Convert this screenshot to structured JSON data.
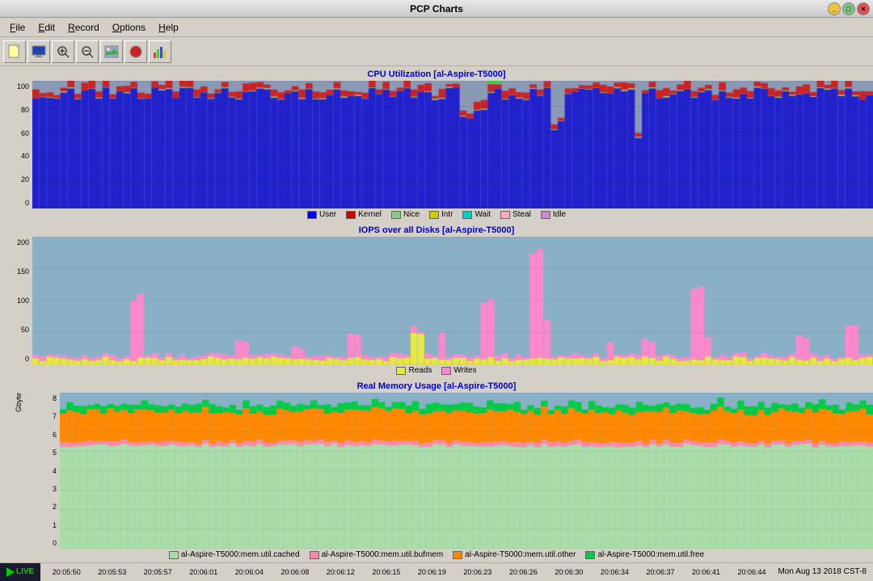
{
  "titlebar": {
    "title": "PCP Charts"
  },
  "menubar": {
    "items": [
      {
        "label": "File",
        "underline": "F"
      },
      {
        "label": "Edit",
        "underline": "E"
      },
      {
        "label": "Record",
        "underline": "R"
      },
      {
        "label": "Options",
        "underline": "O"
      },
      {
        "label": "Help",
        "underline": "H"
      }
    ]
  },
  "toolbar": {
    "buttons": [
      {
        "icon": "📄",
        "name": "new-button"
      },
      {
        "icon": "🖥",
        "name": "monitor-button"
      },
      {
        "icon": "🔍+",
        "name": "zoom-in-button"
      },
      {
        "icon": "🔍-",
        "name": "zoom-out-button"
      },
      {
        "icon": "🖼",
        "name": "export-button"
      },
      {
        "icon": "⏺",
        "name": "record-button"
      },
      {
        "icon": "📈",
        "name": "chart-button"
      }
    ]
  },
  "charts": [
    {
      "id": "cpu",
      "title": "CPU Utilization [al-Aspire-T5000]",
      "ymax": 100,
      "yticks": [
        0,
        20,
        40,
        60,
        80,
        100
      ],
      "legend": [
        {
          "label": "User",
          "color": "#0000ff"
        },
        {
          "label": "Kernel",
          "color": "#cc0000"
        },
        {
          "label": "Nice",
          "color": "#88cc88"
        },
        {
          "label": "Intr",
          "color": "#cccc00"
        },
        {
          "label": "Wait",
          "color": "#00cccc"
        },
        {
          "label": "Steal",
          "color": "#ffaacc"
        },
        {
          "label": "Idle",
          "color": "#cc88cc"
        }
      ]
    },
    {
      "id": "iops",
      "title": "IOPS over all Disks [al-Aspire-T5000]",
      "ymax": 200,
      "yticks": [
        0,
        50,
        100,
        150,
        200
      ],
      "legend": [
        {
          "label": "Reads",
          "color": "#e8e840"
        },
        {
          "label": "Writes",
          "color": "#ff88cc"
        }
      ]
    },
    {
      "id": "memory",
      "title": "Real Memory Usage [al-Aspire-T5000]",
      "ymax": 8,
      "yticks": [
        0,
        1,
        2,
        3,
        4,
        5,
        6,
        7,
        8
      ],
      "ylabel": "Gbyte",
      "legend": [
        {
          "label": "al-Aspire-T5000:mem.util.cached",
          "color": "#aaddaa"
        },
        {
          "label": "al-Aspire-T5000:mem.util.bufmem",
          "color": "#ff88aa"
        },
        {
          "label": "al-Aspire-T5000:mem.util.other",
          "color": "#ff8800"
        },
        {
          "label": "al-Aspire-T5000:mem.util.free",
          "color": "#00cc44"
        }
      ]
    }
  ],
  "timeaxis": {
    "labels": [
      "20:05:50",
      "20:05:53",
      "20:05:57",
      "20:06:01",
      "20:06:04",
      "20:06:08",
      "20:06:12",
      "20:06:15",
      "20:06:19",
      "20:06:23",
      "20:06:26",
      "20:06:30",
      "20:06:34",
      "20:06:37",
      "20:06:41",
      "20:06:44"
    ]
  },
  "statusbar": {
    "live_label": "LIVE",
    "datetime": "Mon Aug 13 2018 CST-8"
  }
}
